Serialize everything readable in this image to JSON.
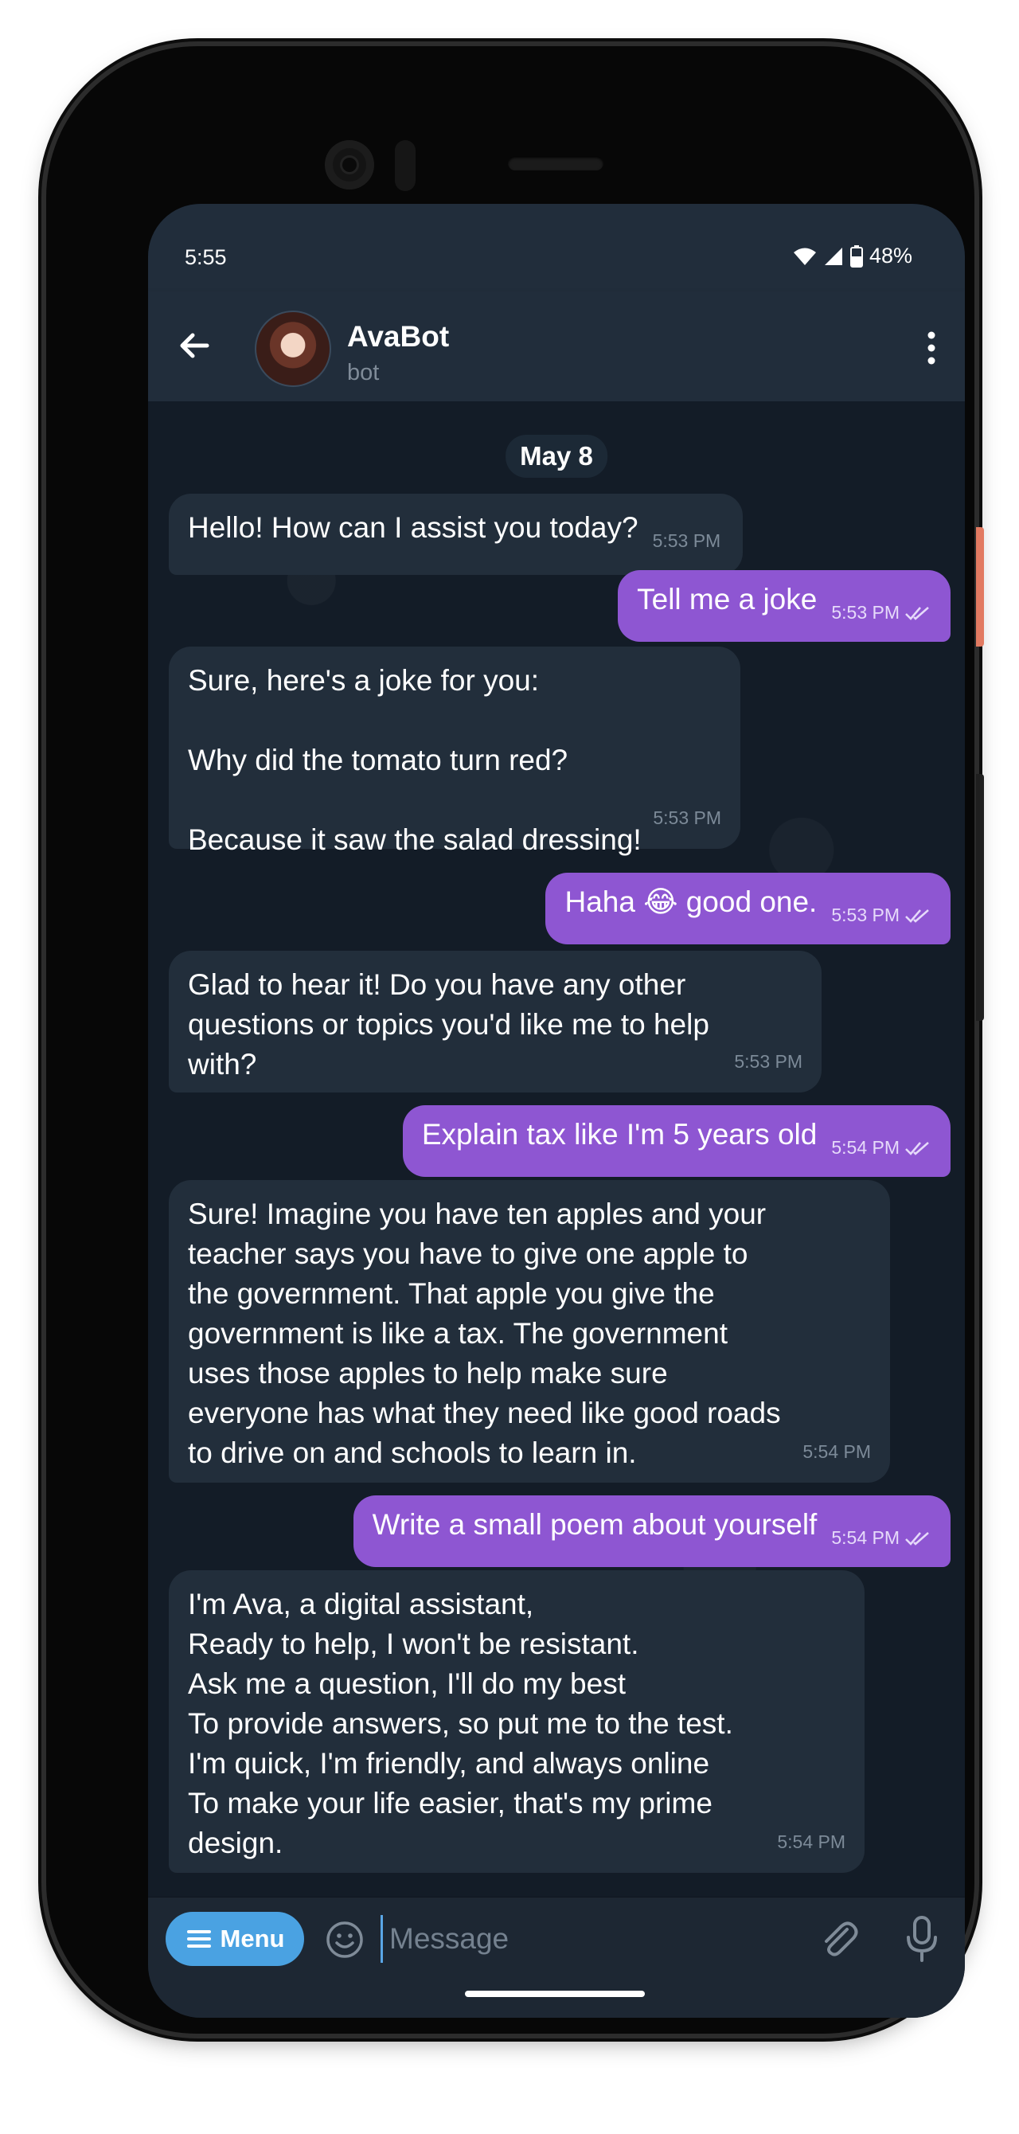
{
  "status_bar": {
    "time": "5:55",
    "battery": "48%"
  },
  "header": {
    "title": "AvaBot",
    "subtitle": "bot"
  },
  "chat": {
    "date": "May 8",
    "messages": [
      {
        "dir": "in",
        "text": "Hello! How can I assist you today?",
        "time": "5:53 PM"
      },
      {
        "dir": "out",
        "text": "Tell me a joke",
        "time": "5:53 PM"
      },
      {
        "dir": "in",
        "text": "Sure, here's a joke for you:\n\nWhy did the tomato turn red?\n\nBecause it saw the salad dressing!",
        "time": "5:53 PM"
      },
      {
        "dir": "out",
        "text": "Haha 😂 good one.",
        "time": "5:53 PM"
      },
      {
        "dir": "in",
        "text": "Glad to hear it! Do you have any other\nquestions or topics you'd like me to help\nwith?",
        "time": "5:53 PM"
      },
      {
        "dir": "out",
        "text": "Explain tax like I'm 5 years old",
        "time": "5:54 PM"
      },
      {
        "dir": "in",
        "text": "Sure! Imagine you have ten apples and your\nteacher says you have to give one apple to\nthe government. That apple you give the\ngovernment is like a tax. The government\nuses those apples to help make sure\neveryone has what they need like good roads\nto drive on and schools to learn in.",
        "time": "5:54 PM"
      },
      {
        "dir": "out",
        "text": "Write a small poem about yourself",
        "time": "5:54 PM"
      },
      {
        "dir": "in",
        "text": "I'm Ava, a digital assistant,\nReady to help, I won't be resistant.\nAsk me a question, I'll do my best\nTo provide answers, so put me to the test.\nI'm quick, I'm friendly, and always online\nTo make your life easier, that's my prime\ndesign.",
        "time": "5:54 PM"
      }
    ]
  },
  "input": {
    "menu_label": "Menu",
    "placeholder": "Message"
  },
  "colors": {
    "outgoing_bubble": "#8e56d2",
    "incoming_bubble": "#222e3b",
    "menu_button": "#4aa2e2",
    "header": "#212d3b"
  },
  "icons": [
    "back-arrow-icon",
    "more-vert-icon",
    "wifi-icon",
    "signal-icon",
    "battery-icon",
    "read-ticks-icon",
    "menu-icon",
    "emoji-icon",
    "attach-icon",
    "mic-icon"
  ]
}
